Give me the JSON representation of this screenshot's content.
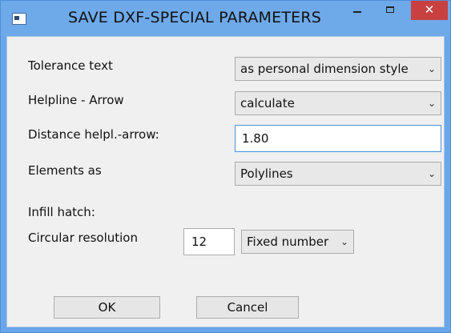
{
  "window": {
    "title": "SAVE DXF-SPECIAL PARAMETERS",
    "minimize_label": "–",
    "maximize_label": "□",
    "close_label": "✕"
  },
  "form": {
    "tolerance_text": {
      "label": "Tolerance text",
      "value": "as personal dimension style"
    },
    "helpline_arrow": {
      "label": "Helpline - Arrow",
      "value": "calculate"
    },
    "distance": {
      "label": "Distance helpl.-arrow:",
      "value": "1.80"
    },
    "elements_as": {
      "label": "Elements as",
      "value": "Polylines"
    },
    "infill_hatch": {
      "label": "Infill hatch:"
    },
    "circular_resolution": {
      "label": "Circular resolution",
      "value": "12",
      "mode": "Fixed number"
    }
  },
  "buttons": {
    "ok": "OK",
    "cancel": "Cancel"
  },
  "icons": {
    "app": "app-window-icon",
    "dropdown": "chevron-down-icon"
  }
}
